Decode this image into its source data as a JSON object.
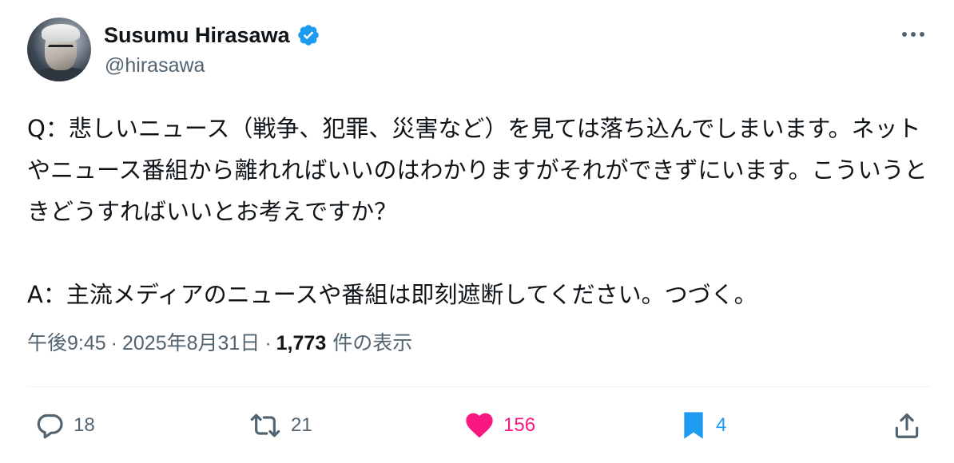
{
  "author": {
    "display_name": "Susumu Hirasawa",
    "handle": "@hirasawa",
    "verified": true,
    "verified_color": "#1d9bf0"
  },
  "tweet": {
    "text": "Q：悲しいニュース（戦争、犯罪、災害など）を見ては落ち込んでしまいます。ネットやニュース番組から離れればいいのはわかりますがそれができずにいます。こういうときどうすればいいとお考えですか？\n\nA：主流メディアのニュースや番組は即刻遮断してください。つづく。",
    "time": "午後9:45",
    "separator": "·",
    "date": "2025年8月31日",
    "views_count": "1,773",
    "views_label": "件の表示"
  },
  "actions": {
    "replies": "18",
    "retweets": "21",
    "likes": "156",
    "bookmarks": "4"
  },
  "icons": {
    "more": "more-icon",
    "reply": "reply-icon",
    "retweet": "retweet-icon",
    "like": "heart-icon",
    "bookmark": "bookmark-icon",
    "share": "share-icon"
  },
  "colors": {
    "like_active": "#f91880",
    "bookmark_active": "#1d9bf0",
    "secondary_text": "#536471"
  }
}
